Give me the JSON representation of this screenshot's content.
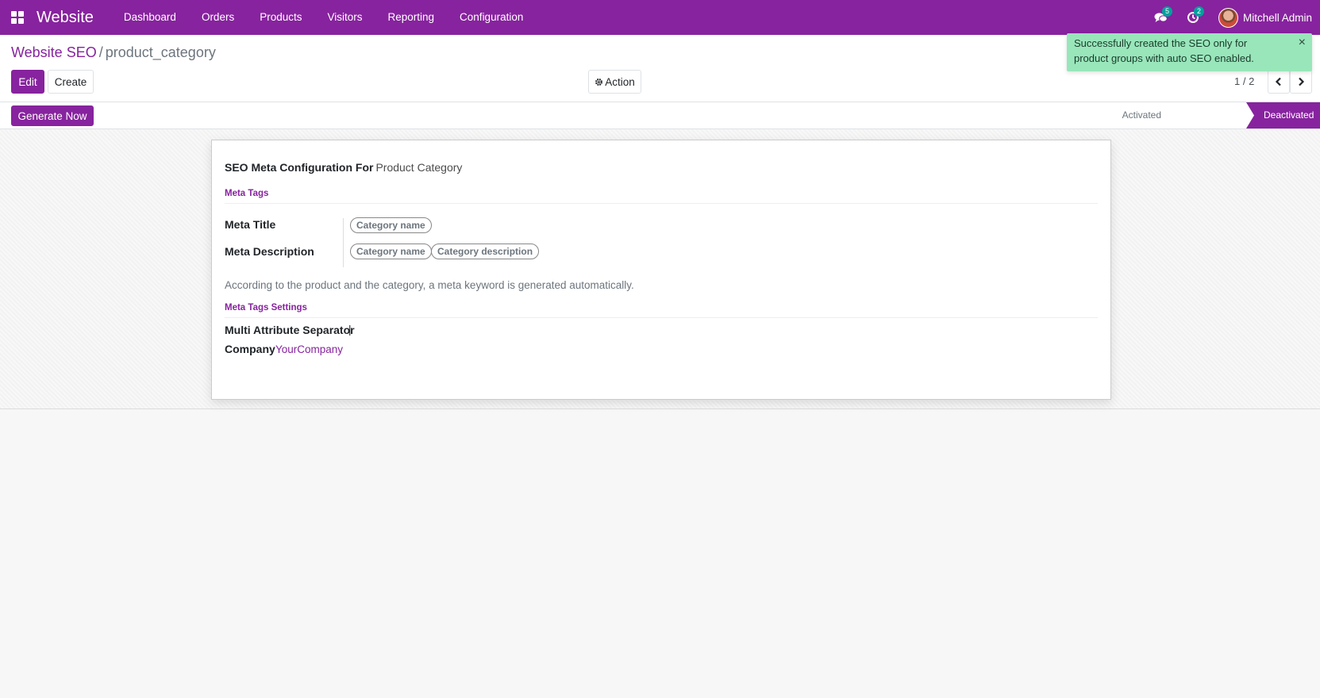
{
  "navbar": {
    "brand": "Website",
    "menu": [
      "Dashboard",
      "Orders",
      "Products",
      "Visitors",
      "Reporting",
      "Configuration"
    ],
    "messages_count": "5",
    "activities_count": "2",
    "user_name": "Mitchell Admin"
  },
  "breadcrumb": {
    "parent": "Website SEO",
    "separator": "/",
    "current": "product_category"
  },
  "buttons": {
    "edit": "Edit",
    "create": "Create",
    "action": "Action",
    "generate": "Generate Now"
  },
  "pager": {
    "value": "1 / 2"
  },
  "statusbar": {
    "stages": [
      "Activated",
      "Deactivated"
    ],
    "active": "Deactivated"
  },
  "form": {
    "heading_label": "SEO Meta Configuration For",
    "heading_value": "Product Category",
    "meta_tags_title": "Meta Tags",
    "meta_title_label": "Meta Title",
    "meta_title_tags": [
      "Category name"
    ],
    "meta_description_label": "Meta Description",
    "meta_description_tags": [
      "Category name",
      "Category description"
    ],
    "help_text": "According to the product and the category, a meta keyword is generated automatically.",
    "settings_title": "Meta Tags Settings",
    "separator_label": "Multi Attribute Separator",
    "separator_value": "|",
    "company_label": "Company",
    "company_value": "YourCompany"
  },
  "notification": {
    "message": "Successfully created the SEO only for product groups with auto SEO enabled.",
    "close": "×"
  },
  "colors": {
    "brand": "#87239e",
    "badge": "#00a09d",
    "toast": "#99e6bb"
  }
}
